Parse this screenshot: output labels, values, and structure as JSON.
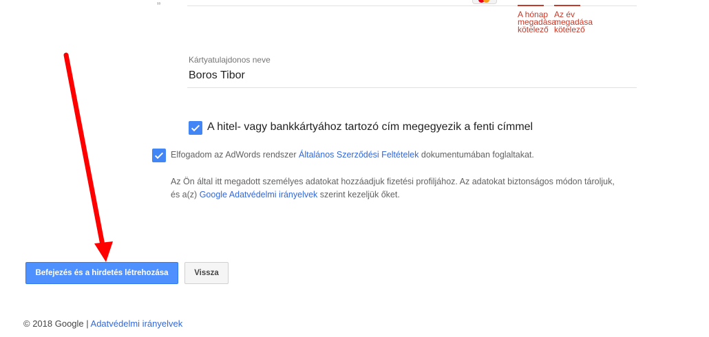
{
  "form": {
    "month_error": "A hónap megadása kötelező",
    "year_error": "Az év megadása kötelező",
    "cardholder_label": "Kártyatulajdonos neve",
    "cardholder_value": "Boros Tibor",
    "same_address_label": "A hitel- vagy bankkártyához tartozó cím megegyezik a fenti címmel"
  },
  "terms": {
    "prefix": "Elfogadom az AdWords rendszer ",
    "link": "Általános Szerződési Feltételek",
    "suffix": " dokumentumában foglaltakat."
  },
  "privacy_note": {
    "line1": "Az Ön által itt megadott személyes adatokat hozzáadjuk fizetési profiljához. Az adatokat biztonságos módon tároljuk,",
    "prefix": "és a(z) ",
    "link": "Google Adatvédelmi irányelvek",
    "suffix": " szerint kezeljük őket."
  },
  "buttons": {
    "submit": "Befejezés és a hirdetés létrehozása",
    "back": "Vissza"
  },
  "footer": {
    "copyright": "© 2018 Google | ",
    "privacy_link": "Adatvédelmi irányelvek"
  },
  "colors": {
    "primary": "#4d90fe",
    "checkbox": "#4285f4",
    "error": "#c53929",
    "link": "#3367d6",
    "annotation_arrow": "#ff0000"
  }
}
